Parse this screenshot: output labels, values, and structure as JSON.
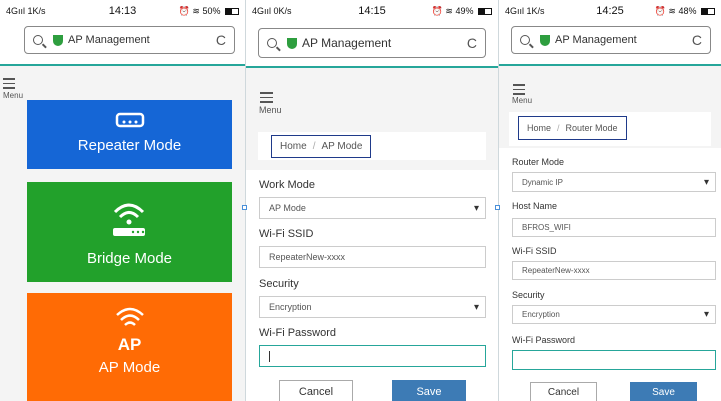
{
  "screens": [
    {
      "status": {
        "network": "4Gııl 1K/s",
        "time": "14:13",
        "battery": "50%"
      },
      "url": {
        "text": "AP Management",
        "reload": "C"
      },
      "menu_label": "Menu",
      "modes": [
        {
          "label": "Repeater Mode",
          "icon": "router-icon",
          "color": "#1566d6"
        },
        {
          "label": "Bridge Mode",
          "icon": "wifi-router-icon",
          "color": "#22a12b"
        },
        {
          "label": "AP Mode",
          "icon_text": "AP",
          "icon": "wifi-icon",
          "color": "#ff6b05"
        }
      ]
    },
    {
      "status": {
        "network": "4Gııl 0K/s",
        "time": "14:15",
        "battery": "49%"
      },
      "url": {
        "text": "AP Management",
        "reload": "C"
      },
      "menu_label": "Menu",
      "breadcrumb": {
        "home": "Home",
        "sep": "/",
        "current": "AP Mode"
      },
      "form": {
        "work_mode_label": "Work Mode",
        "work_mode_value": "AP Mode",
        "ssid_label": "Wi-Fi SSID",
        "ssid_value": "RepeaterNew-xxxx",
        "security_label": "Security",
        "security_value": "Encryption",
        "password_label": "Wi-Fi Password",
        "password_value": ""
      },
      "buttons": {
        "cancel": "Cancel",
        "save": "Save"
      }
    },
    {
      "status": {
        "network": "4Gııl 1K/s",
        "time": "14:25",
        "battery": "48%"
      },
      "url": {
        "text": "AP Management",
        "reload": "C"
      },
      "menu_label": "Menu",
      "breadcrumb": {
        "home": "Home",
        "sep": "/",
        "current": "Router Mode"
      },
      "form": {
        "router_mode_label": "Router Mode",
        "router_mode_value": "Dynamic IP",
        "host_label": "Host Name",
        "host_value": "BFROS_WIFI",
        "ssid_label": "Wi-Fi SSID",
        "ssid_value": "RepeaterNew-xxxx",
        "security_label": "Security",
        "security_value": "Encryption",
        "password_label": "Wi-Fi Password",
        "password_value": ""
      },
      "buttons": {
        "cancel": "Cancel",
        "save": "Save"
      }
    }
  ],
  "colors": {
    "accent": "#26a69a",
    "save": "#3d7bb5",
    "shield": "#2e9e3f"
  }
}
